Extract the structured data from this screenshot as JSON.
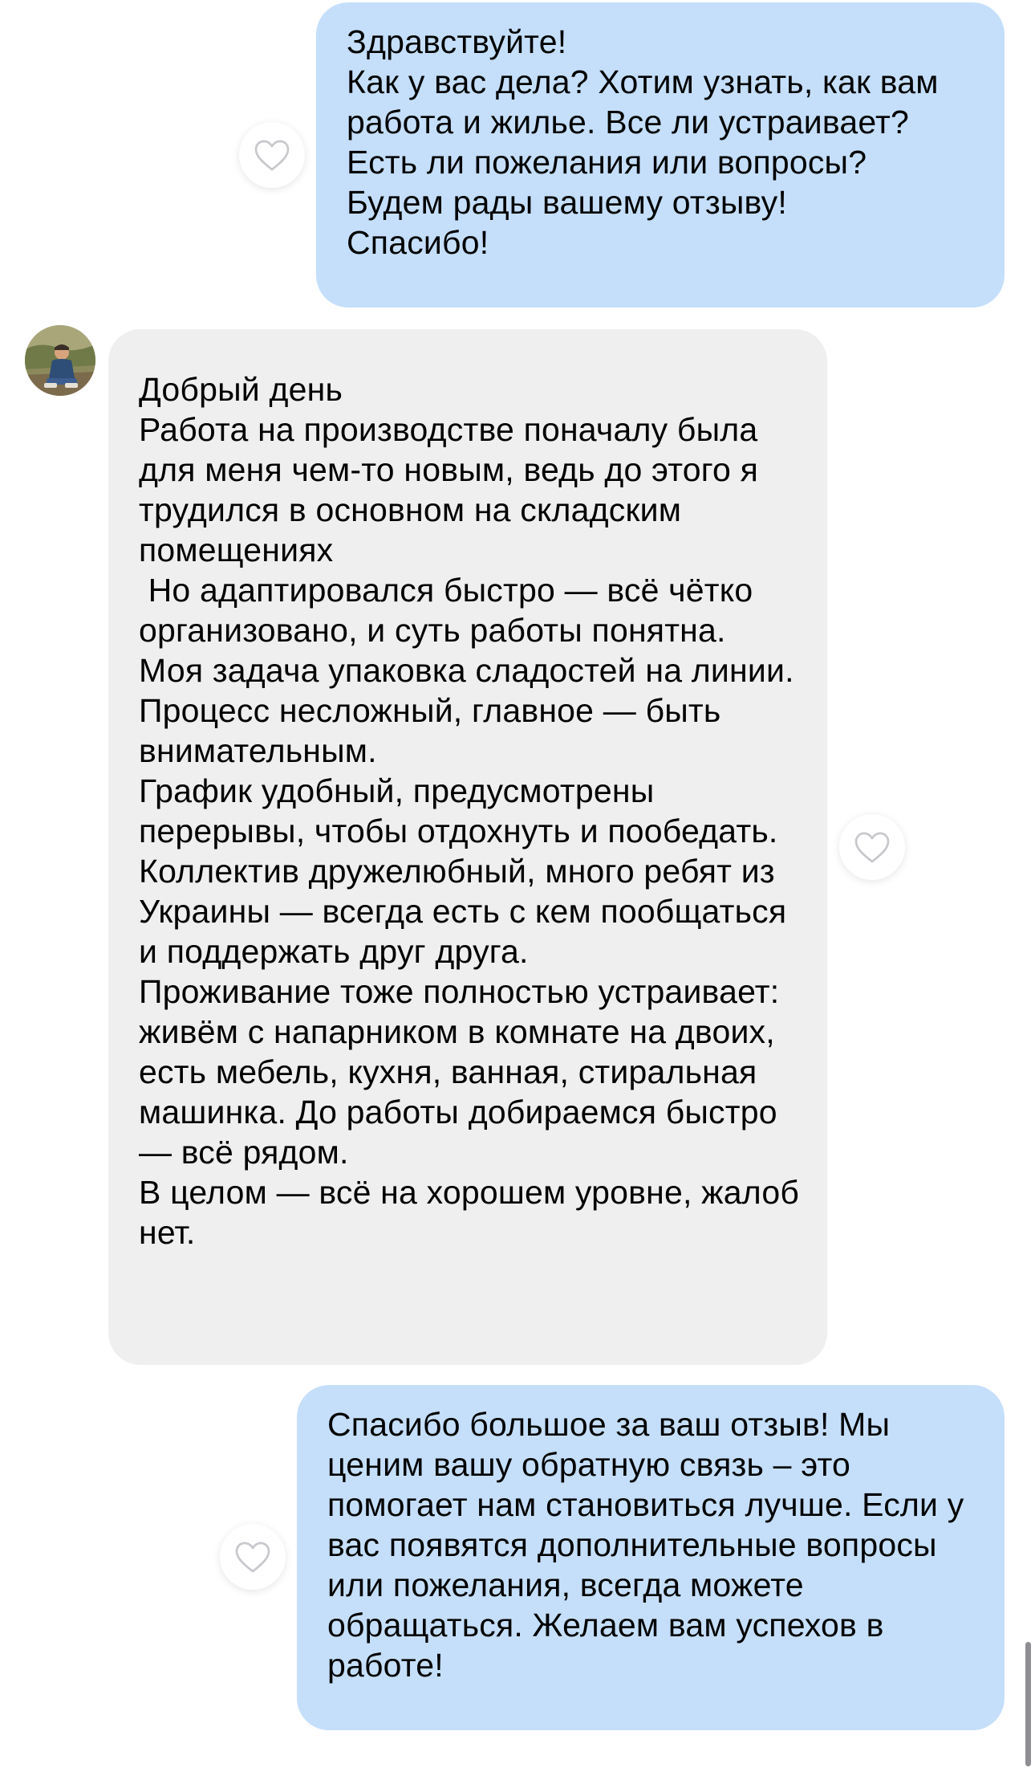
{
  "messages": [
    {
      "direction": "outgoing",
      "text": "Здравствуйте!\nКак у вас дела? Хотим узнать, как вам работа и жилье. Все ли устраивает?\nЕсть ли пожелания или вопросы?\nБудем рады вашему отзыву!\nСпасибо!"
    },
    {
      "direction": "incoming",
      "text": "Добрый день\nРабота на производстве поначалу была для меня чем-то новым, ведь до этого я трудился в основном на складским помещениях\n Но адаптировался быстро — всё чётко организовано, и суть работы понятна.\nМоя задача упаковка сладостей на линии. Процесс несложный, главное — быть внимательным.\nГрафик удобный, предусмотрены перерывы, чтобы отдохнуть и пообедать.\nКоллектив дружелюбный, много ребят из Украины — всегда есть с кем пообщаться и поддержать друг друга.\nПроживание тоже полностью устраивает: живём с напарником в комнате на двоих, есть мебель, кухня, ванная, стиральная машинка. До работы добираемся быстро — всё рядом.\nВ целом — всё на хорошем уровне, жалоб нет."
    },
    {
      "direction": "outgoing",
      "text": "Спасибо большое за ваш отзыв! Мы ценим вашу обратную связь – это помогает нам становиться лучше. Если у вас появятся дополнительные вопросы или пожелания, всегда можете обращаться. Желаем вам успехов в работе!"
    }
  ],
  "icons": {
    "like": "heart-outline-icon",
    "avatar": "contact-avatar-photo"
  },
  "colors": {
    "outgoing_bubble": "#c5dffb",
    "incoming_bubble": "#efefef",
    "heart_stroke": "#c7c7cc"
  }
}
